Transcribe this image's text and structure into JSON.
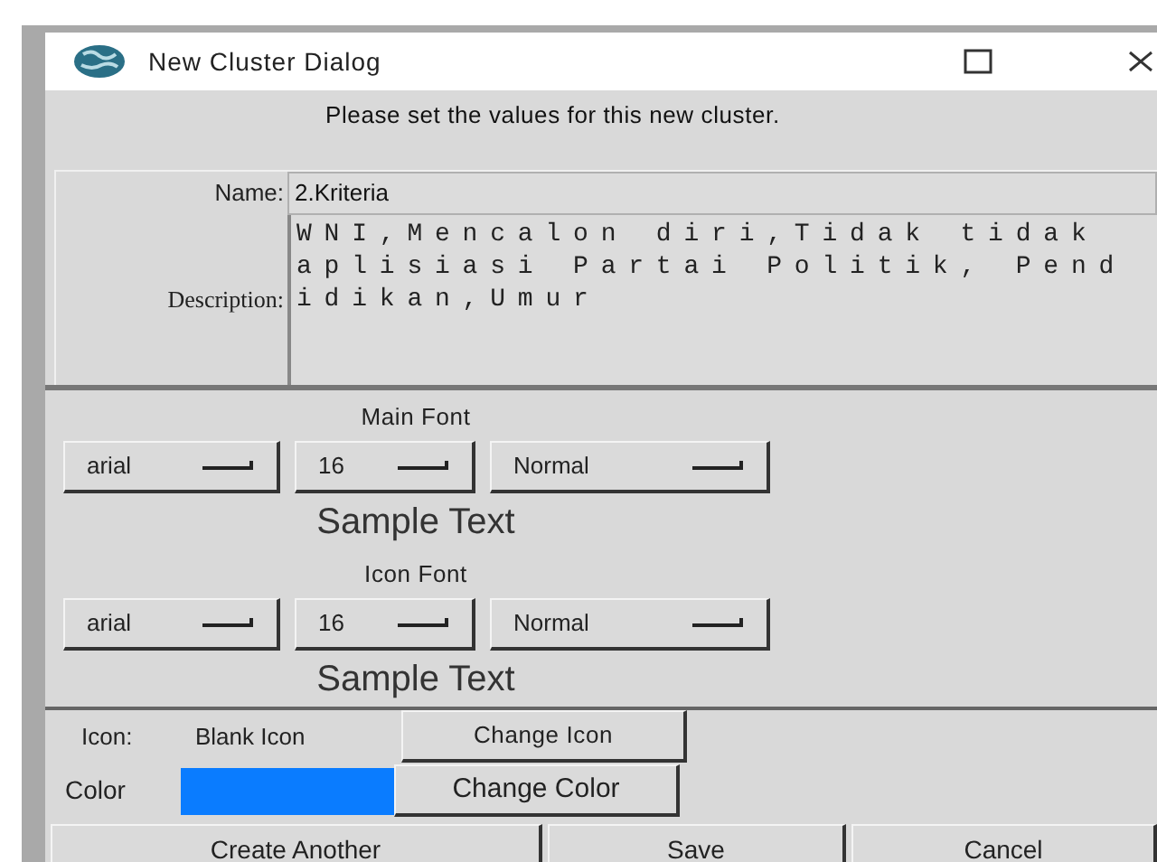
{
  "window": {
    "title": "New Cluster Dialog"
  },
  "prompt": "Please set the values for this new cluster.",
  "name": {
    "label": "Name:",
    "value": "2.Kriteria"
  },
  "description": {
    "label": "Description:",
    "value": "WNI,Mencalon diri,Tidak tidak aplisiasi Partai Politik, Pendidikan,Umur"
  },
  "font_sections": [
    {
      "title": "Main Font",
      "dropdowns": [
        "arial",
        "16",
        "Normal"
      ],
      "sample": "Sample Text"
    },
    {
      "title": "Icon Font",
      "dropdowns": [
        "arial",
        "16",
        "Normal"
      ],
      "sample": "Sample Text"
    }
  ],
  "icon": {
    "label": "Icon:",
    "value": "Blank Icon",
    "button": "Change Icon"
  },
  "color": {
    "label": "Color",
    "color": "#0a7cff",
    "button": "Change Color"
  },
  "buttons": [
    "Create Another",
    "Save",
    "Cancel"
  ]
}
